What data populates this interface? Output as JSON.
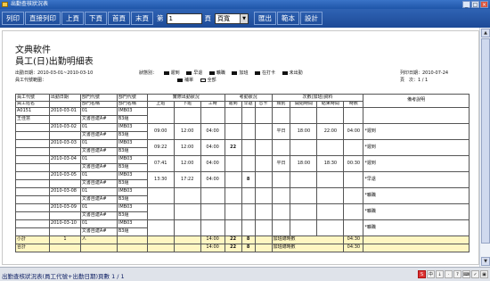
{
  "window": {
    "title": "出勤查核狀況表",
    "min": "_",
    "max": "□",
    "close": "×"
  },
  "toolbar": {
    "print": "列印",
    "print_direct": "直接列印",
    "prev_page": "上頁",
    "next_page": "下頁",
    "first_page": "首頁",
    "last_page": "末頁",
    "goto_prefix": "第",
    "page_value": "1",
    "goto_suffix": "頁",
    "view_select": "頁寬",
    "export": "匯出",
    "sample": "範本",
    "settings": "設計"
  },
  "report": {
    "company": "文典軟件",
    "title": "員工(日)出勤明細表",
    "date_range": "出勤日期：2010-03-01~2010-03-10",
    "status_label": "狀態別：",
    "legend": [
      "遲到",
      "早退",
      "曠職",
      "加班",
      "在打卡",
      "未出勤",
      "補單",
      "全部"
    ],
    "employee_filter": "員工代號範圍：",
    "print_date": "列印日期：2010-07-24",
    "page_info": "頁　次：1 / 1"
  },
  "table": {
    "groups": [
      "實際出勤狀況",
      "考勤狀況",
      "次數(加班)資料",
      "備考說明"
    ],
    "headers": [
      "員工代號",
      "出勤日期",
      "部門代號",
      "部門代號",
      "上班",
      "下班",
      "工時",
      "遲到",
      "早退",
      "忘卡",
      "類別",
      "開始時間",
      "結束時間",
      "時數"
    ],
    "headers2": [
      "員工姓名",
      "",
      "部門名稱",
      "部門名稱"
    ],
    "emp_id": "A0151",
    "emp_name": "王佳慧",
    "rows": [
      {
        "date": "2010-03-01",
        "dept_code": "01",
        "dept_name": "文書自建A#",
        "unit_code": "IMB03",
        "unit_name": "B3組",
        "in": "",
        "out": "",
        "hours": "",
        "late": "",
        "early": "",
        "forgot": "",
        "ot_type": "",
        "ot_start": "",
        "ot_end": "",
        "ot_hours": "",
        "note": ""
      },
      {
        "date": "2010-03-02",
        "dept_code": "01",
        "dept_name": "文書自建A#",
        "unit_code": "IMB03",
        "unit_name": "B3組",
        "in": "09:00",
        "out": "12:00",
        "hours": "04:00",
        "late": "",
        "early": "",
        "forgot": "",
        "ot_type": "平日",
        "ot_start": "18:00",
        "ot_end": "22:00",
        "ot_hours": "04:00",
        "note": "*遲到"
      },
      {
        "date": "2010-03-03",
        "dept_code": "01",
        "dept_name": "文書自建A#",
        "unit_code": "IMB03",
        "unit_name": "B3組",
        "in": "09:22",
        "out": "12:00",
        "hours": "04:00",
        "late": "22",
        "early": "",
        "forgot": "",
        "ot_type": "",
        "ot_start": "",
        "ot_end": "",
        "ot_hours": "",
        "note": "*遲到"
      },
      {
        "date": "2010-03-04",
        "dept_code": "01",
        "dept_name": "文書自建A#",
        "unit_code": "IMB03",
        "unit_name": "B3組",
        "in": "07:41",
        "out": "12:00",
        "hours": "04:00",
        "late": "",
        "early": "",
        "forgot": "",
        "ot_type": "平日",
        "ot_start": "18:00",
        "ot_end": "18:30",
        "ot_hours": "00:30",
        "note": "*遲到"
      },
      {
        "date": "2010-03-05",
        "dept_code": "01",
        "dept_name": "文書自建A#",
        "unit_code": "IMB03",
        "unit_name": "B3組",
        "in": "13:30",
        "out": "17:22",
        "hours": "04:00",
        "late": "",
        "early": "8",
        "forgot": "",
        "ot_type": "",
        "ot_start": "",
        "ot_end": "",
        "ot_hours": "",
        "note": "*早退"
      },
      {
        "date": "2010-03-08",
        "dept_code": "01",
        "dept_name": "文書自建A#",
        "unit_code": "IMB03",
        "unit_name": "B3組",
        "in": "",
        "out": "",
        "hours": "",
        "late": "",
        "early": "",
        "forgot": "",
        "ot_type": "",
        "ot_start": "",
        "ot_end": "",
        "ot_hours": "",
        "note": "*曠職"
      },
      {
        "date": "2010-03-09",
        "dept_code": "01",
        "dept_name": "文書自建A#",
        "unit_code": "IMB03",
        "unit_name": "B3組",
        "in": "",
        "out": "",
        "hours": "",
        "late": "",
        "early": "",
        "forgot": "",
        "ot_type": "",
        "ot_start": "",
        "ot_end": "",
        "ot_hours": "",
        "note": "*曠職"
      },
      {
        "date": "2010-03-10",
        "dept_code": "01",
        "dept_name": "文書自建A#",
        "unit_code": "IMB03",
        "unit_name": "B3組",
        "in": "",
        "out": "",
        "hours": "",
        "late": "",
        "early": "",
        "forgot": "",
        "ot_type": "",
        "ot_start": "",
        "ot_end": "",
        "ot_hours": "",
        "note": "*曠職"
      }
    ],
    "subtotal": {
      "label": "小計",
      "count": "1",
      "unit": "人",
      "hours": "14:00",
      "late": "22",
      "early": "8",
      "ot_label": "加班總時數",
      "ot_total": "04:30"
    },
    "total": {
      "label": "合計",
      "hours": "14:00",
      "late": "22",
      "early": "8",
      "ot_label": "加班總時數",
      "ot_total": "04:30"
    }
  },
  "status": {
    "text": "出勤查核狀況表(員工代號+出勤日期)頁數 1 / 1"
  },
  "tray": [
    "S",
    "中",
    "↓",
    "·",
    "?",
    "⌨",
    "✓",
    "▣"
  ]
}
